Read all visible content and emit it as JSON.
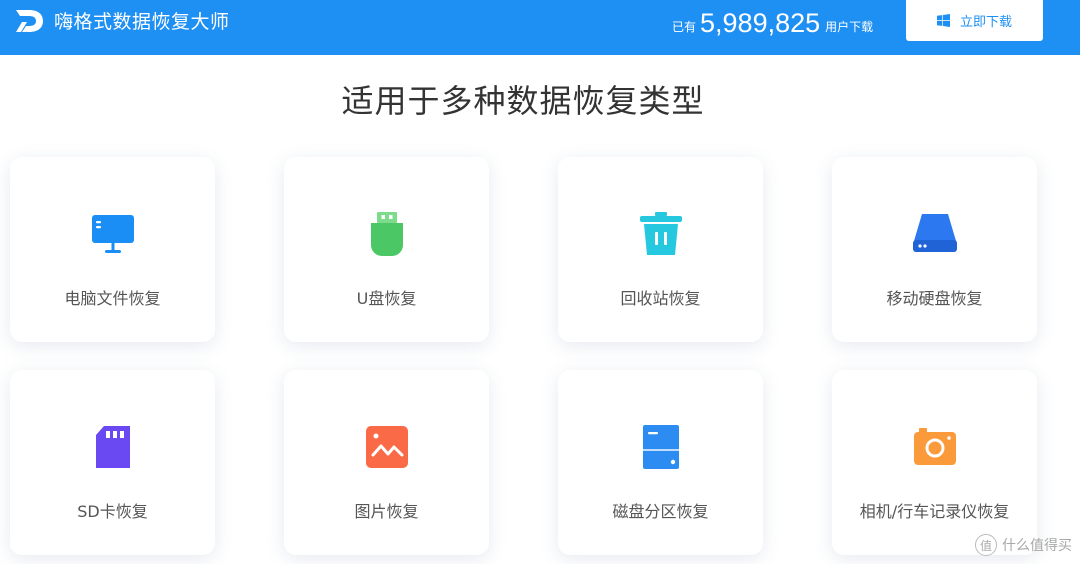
{
  "header": {
    "logo_icon": "d-logo-icon",
    "brand": "嗨格式数据恢复大师",
    "download_prefix": "已有",
    "download_count": "5,989,825",
    "download_suffix": "用户下载",
    "download_button_label": "立即下载",
    "download_button_icon": "windows-icon",
    "colors": {
      "primary": "#1e8ff3",
      "button_text": "#1e8ff3"
    }
  },
  "main": {
    "title": "适用于多种数据恢复类型",
    "cards": [
      {
        "label": "电脑文件恢复",
        "icon": "monitor-icon",
        "color": "#1b8ef5"
      },
      {
        "label": "U盘恢复",
        "icon": "usb-drive-icon",
        "color": "#4cc765"
      },
      {
        "label": "回收站恢复",
        "icon": "trash-bin-icon",
        "color": "#25c8df"
      },
      {
        "label": "移动硬盘恢复",
        "icon": "hard-drive-icon",
        "color": "#2b78f0"
      },
      {
        "label": "SD卡恢复",
        "icon": "sd-card-icon",
        "color": "#6a49f2"
      },
      {
        "label": "图片恢复",
        "icon": "image-icon",
        "color": "#fb6a47"
      },
      {
        "label": "磁盘分区恢复",
        "icon": "disk-partition-icon",
        "color": "#2c8cf2"
      },
      {
        "label": "相机/行车记录仪恢复",
        "icon": "camera-icon",
        "color": "#fb9a3b"
      }
    ]
  },
  "watermark": {
    "badge": "值",
    "text": "什么值得买"
  }
}
